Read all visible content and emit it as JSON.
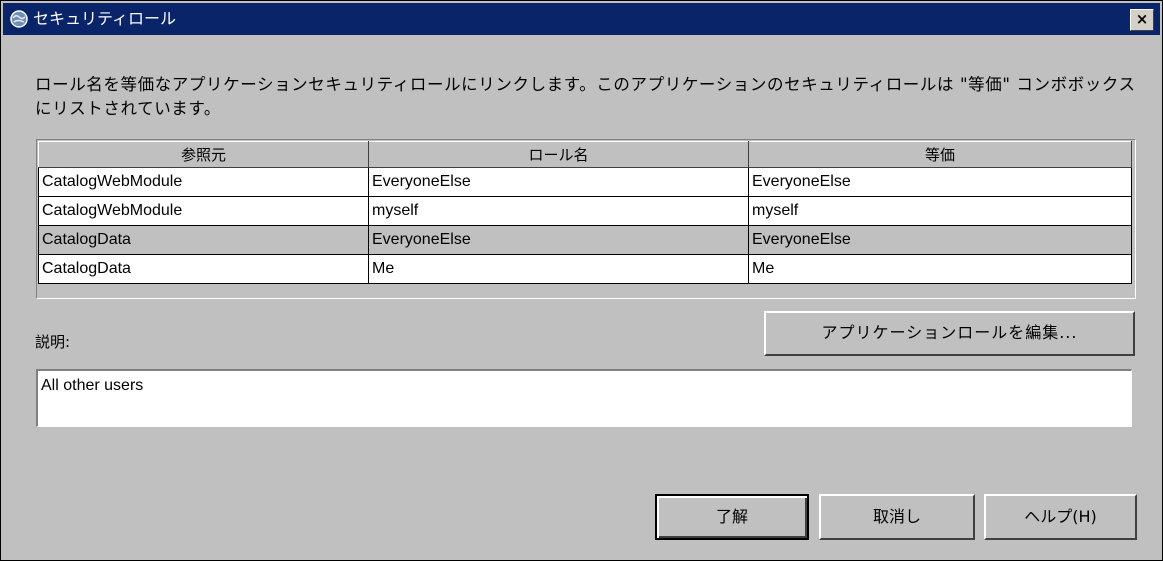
{
  "window": {
    "title": "セキュリティロール",
    "close_label": "×"
  },
  "instructions": "ロール名を等価なアプリケーションセキュリティロールにリンクします。このアプリケーションのセキュリティロールは \"等価\" コンボボックスにリストされています。",
  "table": {
    "headers": [
      "参照元",
      "ロール名",
      "等価"
    ],
    "rows": [
      [
        "CatalogWebModule",
        "EveryoneElse",
        "EveryoneElse"
      ],
      [
        "CatalogWebModule",
        "myself",
        "myself"
      ],
      [
        "CatalogData",
        "EveryoneElse",
        "EveryoneElse"
      ],
      [
        "CatalogData",
        "Me",
        "Me"
      ]
    ]
  },
  "description": {
    "label": "説明:",
    "value": "All other users"
  },
  "buttons": {
    "edit_roles": "アプリケーションロールを編集...",
    "ok": "了解",
    "cancel": "取消し",
    "help": "ヘルプ(H)"
  }
}
